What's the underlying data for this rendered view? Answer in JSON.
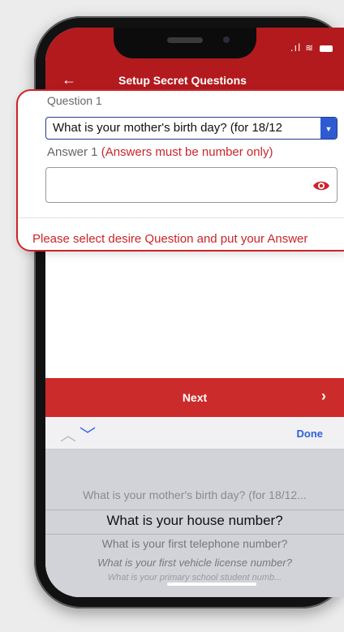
{
  "header": {
    "title": "Setup Secret Questions"
  },
  "form": {
    "question_label": "Question 1",
    "question_value": "What is your mother's birth day? (for 18/12",
    "answer_label": "Answer 1",
    "answer_note": "(Answers must be number only)",
    "answer_value": "",
    "instruction": "Please select desire Question and put your Answer"
  },
  "actions": {
    "next_label": "Next",
    "done_label": "Done"
  },
  "picker": {
    "options": [
      "What is your mother's birth day? (for 18/12...",
      "What is your house number?",
      "What is your first telephone number?",
      "What is your first vehicle license number?",
      "What is your primary school student numb..."
    ],
    "selected_index": 1
  },
  "colors": {
    "brand_red": "#b21a1e",
    "accent_red": "#c9252b",
    "ios_blue": "#2c63d6"
  }
}
